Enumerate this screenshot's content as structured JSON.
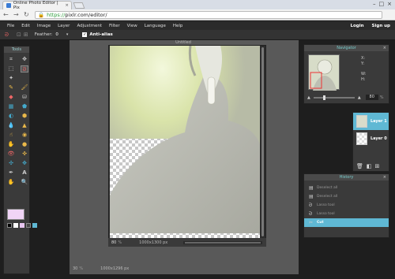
{
  "browser": {
    "tab_title": "Online Photo Editor | Pix",
    "tab_close": "×",
    "url_scheme": "https://",
    "url_rest": "pixlr.com/editor/",
    "win_min": "–",
    "win_max": "□",
    "win_close": "×"
  },
  "menu": {
    "items": [
      "File",
      "Edit",
      "Image",
      "Layer",
      "Adjustment",
      "Filter",
      "View",
      "Language",
      "Help"
    ],
    "login": "Login",
    "signup": "Sign up"
  },
  "options": {
    "feather_label": "Feather:",
    "feather_value": "0",
    "antialias_label": "Anti-alias",
    "antialias_checked": true
  },
  "tools": {
    "title": "Tools"
  },
  "document": {
    "title": "Untitled",
    "zoom": "80",
    "size": "1000x1300 px",
    "workspace_zoom": "30",
    "workspace_size": "1000x1296 px"
  },
  "navigator": {
    "title": "Navigator",
    "x_label": "X:",
    "y_label": "Y:",
    "w_label": "W:",
    "h_label": "H:",
    "zoom": "80"
  },
  "layers": {
    "items": [
      {
        "name": "Layer 1",
        "active": true
      },
      {
        "name": "Layer 0",
        "active": false
      }
    ]
  },
  "history": {
    "title": "History",
    "items": [
      {
        "label": "Deselect all",
        "icon": "selection-icon",
        "active": false
      },
      {
        "label": "Deselect all",
        "icon": "selection-icon",
        "active": false
      },
      {
        "label": "Lasso tool",
        "icon": "lasso-icon",
        "active": false
      },
      {
        "label": "Lasso tool",
        "icon": "lasso-icon",
        "active": false
      },
      {
        "label": "Cut",
        "icon": "cut-icon",
        "active": true
      }
    ]
  },
  "colors": {
    "accent": "#5fb8d4",
    "panel": "#3a3a3a",
    "foreground_swatch": "#f0d4f6"
  }
}
